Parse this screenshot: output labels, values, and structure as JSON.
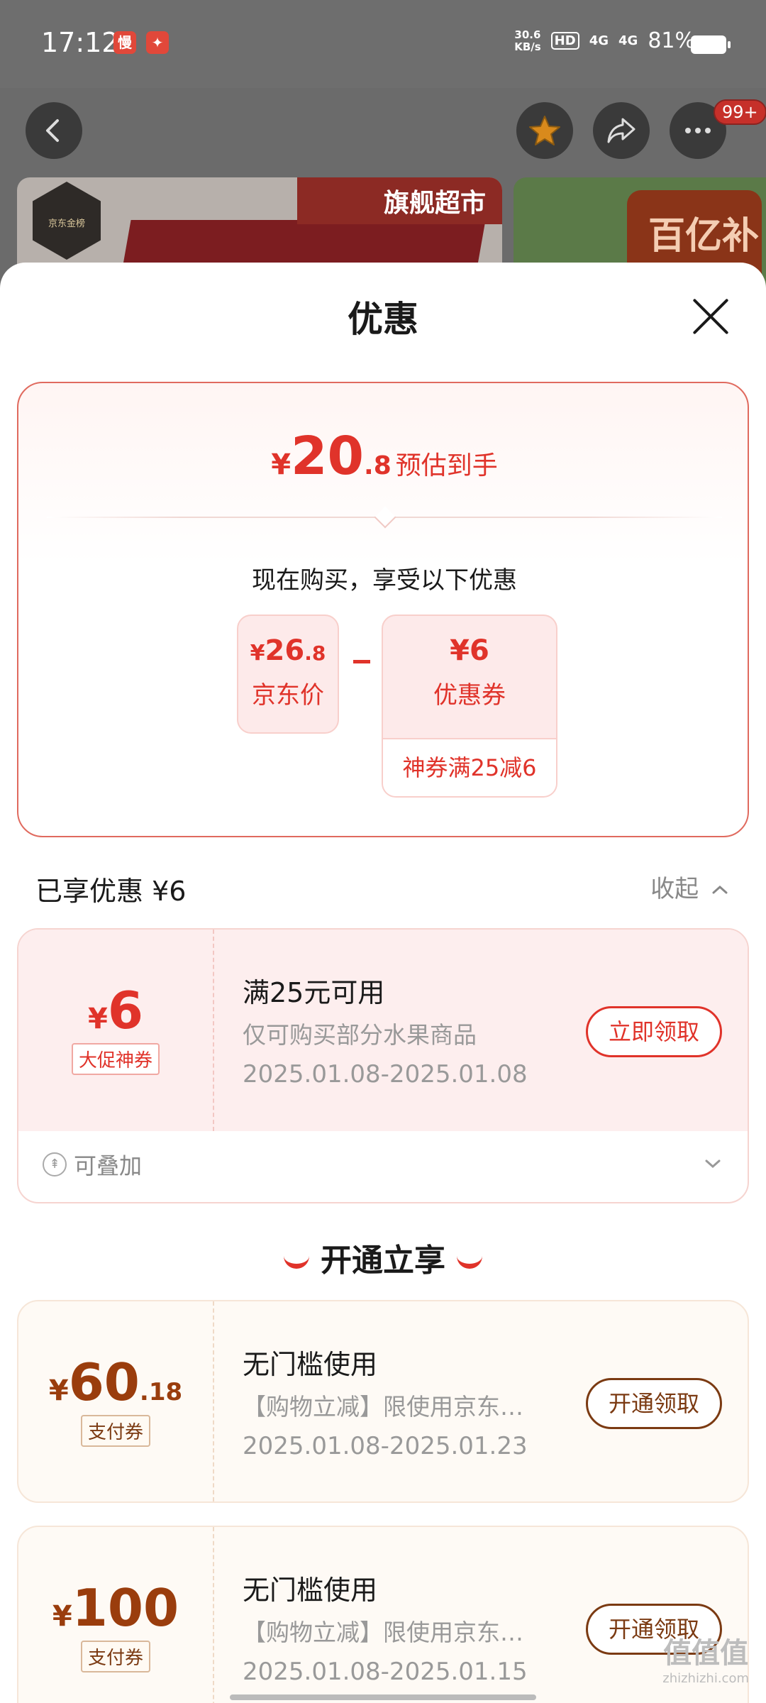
{
  "status_bar": {
    "time": "17:12",
    "net_speed_value": "30.6",
    "net_speed_unit": "KB/s",
    "hd": "HD",
    "signal1": "4G",
    "signal2": "4G",
    "battery": "81%"
  },
  "nav": {
    "back_icon": "chevron-left-icon",
    "favorite_icon": "star-icon",
    "share_icon": "share-icon",
    "more_icon": "more-icon",
    "badge": "99+"
  },
  "banners": {
    "flagship": "旗舰超市",
    "jd_gold": "京东金榜",
    "subsidy": "百亿补贴"
  },
  "sheet": {
    "title": "优惠",
    "close_icon": "close-icon"
  },
  "summary": {
    "yen": "¥",
    "price_int": "20",
    "price_dec": ".8",
    "price_label": "预估到手",
    "buy_now_text": "现在购买，享受以下优惠",
    "jd_price_yen": "¥",
    "jd_price_int": "26",
    "jd_price_dec": ".8",
    "jd_price_label": "京东价",
    "coupon_value": "¥6",
    "coupon_label": "优惠券",
    "coupon_detail": "神券满25减6"
  },
  "applied": {
    "label": "已享优惠 ¥6",
    "collapse_label": "收起"
  },
  "red_coupon": {
    "yen": "¥",
    "amount": "6",
    "tag": "大促神券",
    "title": "满25元可用",
    "desc": "仅可购买部分水果商品",
    "date": "2025.01.08-2025.01.08",
    "button": "立即领取",
    "stack_label": "可叠加"
  },
  "open_section": {
    "title": "开通立享"
  },
  "gold_coupons": [
    {
      "yen": "¥",
      "amount_int": "60",
      "amount_dec": ".18",
      "tag": "支付券",
      "title": "无门槛使用",
      "desc": "【购物立减】限使用京东…",
      "date": "2025.01.08-2025.01.23",
      "button": "开通领取"
    },
    {
      "yen": "¥",
      "amount_int": "100",
      "amount_dec": "",
      "tag": "支付券",
      "title": "无门槛使用",
      "desc": "【购物立减】限使用京东…",
      "date": "2025.01.08-2025.01.15",
      "button": "开通领取"
    }
  ],
  "watermark": {
    "text": "值值值",
    "sub": "zhizhizhi.com"
  },
  "colors": {
    "accent_red": "#e0332a",
    "gold_brown": "#7b3a12"
  }
}
